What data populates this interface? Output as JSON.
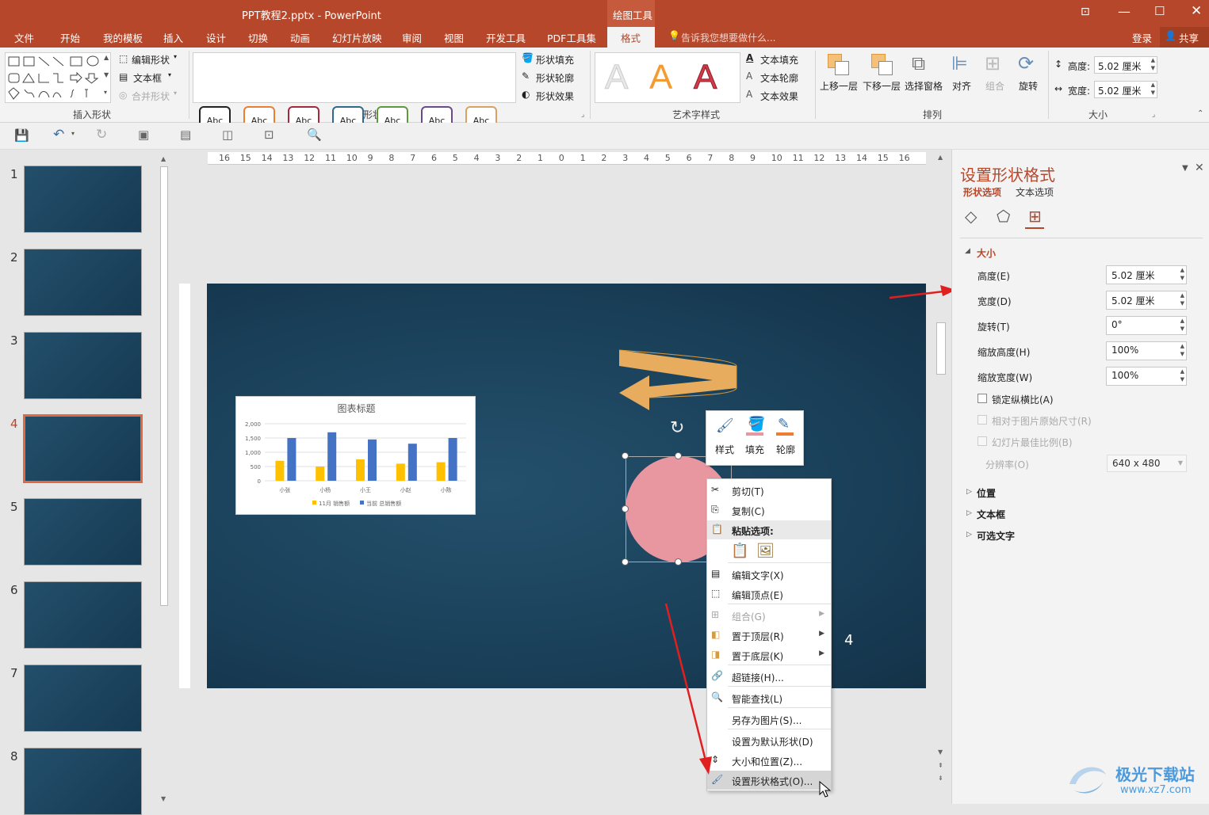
{
  "app": {
    "title": "PPT教程2.pptx - PowerPoint",
    "context_tab_group": "绘图工具",
    "login": "登录",
    "share": "共享"
  },
  "menu": {
    "items": [
      "文件",
      "开始",
      "我的模板",
      "插入",
      "设计",
      "切换",
      "动画",
      "幻灯片放映",
      "审阅",
      "视图",
      "开发工具",
      "PDF工具集",
      "格式"
    ],
    "active": "格式",
    "tell_me": "告诉我您想要做什么..."
  },
  "ribbon": {
    "insert_shapes": {
      "label": "插入形状",
      "edit_shape": "编辑形状",
      "text_box": "文本框",
      "merge_shapes": "合并形状"
    },
    "shape_styles": {
      "label": "形状样式",
      "sample": "Abc",
      "fill": "形状填充",
      "outline": "形状轮廓",
      "effect": "形状效果",
      "colors": [
        "#222222",
        "#ed7d31",
        "#a5283c",
        "#2e6b8a",
        "#5e9a3c",
        "#6b4a8c",
        "#d9a25e"
      ]
    },
    "wordart": {
      "label": "艺术字样式",
      "fill": "文本填充",
      "outline": "文本轮廓",
      "effect": "文本效果",
      "letter": "A"
    },
    "arrange": {
      "label": "排列",
      "bring_forward": "上移一层",
      "send_backward": "下移一层",
      "selection_pane": "选择窗格",
      "align": "对齐",
      "group": "组合",
      "rotate": "旋转"
    },
    "size": {
      "label": "大小",
      "height_label": "高度:",
      "height": "5.02 厘米",
      "width_label": "宽度:",
      "width": "5.02 厘米"
    }
  },
  "slides": [
    {
      "num": "1"
    },
    {
      "num": "2"
    },
    {
      "num": "3"
    },
    {
      "num": "4",
      "active": true
    },
    {
      "num": "5"
    },
    {
      "num": "6"
    },
    {
      "num": "7"
    },
    {
      "num": "8"
    }
  ],
  "slide": {
    "page_number": "4",
    "chart_data": {
      "type": "bar",
      "title": "图表标题",
      "categories": [
        "小张",
        "小杨",
        "小王",
        "小赵",
        "小陈"
      ],
      "series": [
        {
          "name": "11月 销售额",
          "values": [
            700,
            500,
            750,
            600,
            650
          ],
          "color": "#ffc000"
        },
        {
          "name": "当前 总销售额",
          "values": [
            1500,
            1700,
            1450,
            1300,
            1500
          ],
          "color": "#4472c4"
        }
      ],
      "ylim": [
        0,
        2000
      ],
      "yticks": [
        "2,000",
        "1,500",
        "1,000",
        "500",
        "0"
      ]
    }
  },
  "ruler": {
    "h_ticks": [
      "16",
      "15",
      "14",
      "13",
      "12",
      "11",
      "10",
      "9",
      "8",
      "7",
      "6",
      "5",
      "4",
      "3",
      "2",
      "1",
      "0",
      "1",
      "2",
      "3",
      "4",
      "5",
      "6",
      "7",
      "8",
      "9",
      "10",
      "11",
      "12",
      "13",
      "14",
      "15",
      "16"
    ]
  },
  "mini_toolbar": {
    "style": "样式",
    "fill": "填充",
    "outline": "轮廓"
  },
  "context_menu": {
    "cut": "剪切(T)",
    "copy": "复制(C)",
    "paste_options": "粘贴选项:",
    "edit_text": "编辑文字(X)",
    "edit_points": "编辑顶点(E)",
    "group": "组合(G)",
    "bring_front": "置于顶层(R)",
    "send_back": "置于底层(K)",
    "hyperlink": "超链接(H)...",
    "smart_lookup": "智能查找(L)",
    "save_as_picture": "另存为图片(S)...",
    "set_default": "设置为默认形状(D)",
    "size_position": "大小和位置(Z)...",
    "format_shape": "设置形状格式(O)..."
  },
  "format_pane": {
    "title": "设置形状格式",
    "tab_shape": "形状选项",
    "tab_text": "文本选项",
    "size_section": "大小",
    "height_label": "高度(E)",
    "height": "5.02 厘米",
    "width_label": "宽度(D)",
    "width": "5.02 厘米",
    "rotation_label": "旋转(T)",
    "rotation": "0°",
    "scale_h_label": "缩放高度(H)",
    "scale_h": "100%",
    "scale_w_label": "缩放宽度(W)",
    "scale_w": "100%",
    "lock_aspect": "锁定纵横比(A)",
    "relative_original": "相对于图片原始尺寸(R)",
    "best_scale": "幻灯片最佳比例(B)",
    "resolution_label": "分辨率(O)",
    "resolution": "640 x 480",
    "position": "位置",
    "textbox": "文本框",
    "alt_text": "可选文字"
  },
  "watermark": {
    "brand": "极光下载站",
    "url": "www.xz7.com"
  }
}
